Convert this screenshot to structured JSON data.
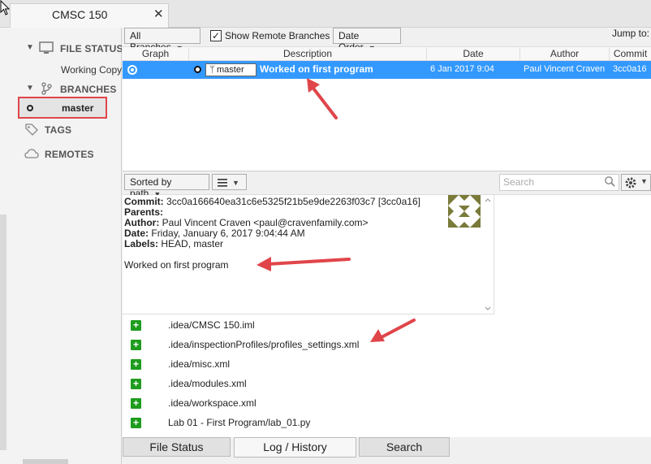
{
  "window": {
    "tab_title": "CMSC 150",
    "close_glyph": "✕"
  },
  "sidebar": {
    "file_status": {
      "label": "FILE STATUS",
      "sub": "Working Copy"
    },
    "branches": {
      "label": "BRANCHES",
      "current": "master"
    },
    "tags": {
      "label": "TAGS"
    },
    "remotes": {
      "label": "REMOTES"
    }
  },
  "toolbar": {
    "branches_filter": "All Branches",
    "show_remote": {
      "label": "Show Remote Branches",
      "checked": true
    },
    "order": "Date Order",
    "jump_to": "Jump to:"
  },
  "log": {
    "columns": [
      "Graph",
      "Description",
      "Date",
      "Author",
      "Commit"
    ],
    "rows": [
      {
        "branch_tag": "master",
        "description": "Worked on first program",
        "date": "6 Jan 2017 9:04",
        "author": "Paul Vincent Craven",
        "commit": "3cc0a16"
      }
    ]
  },
  "file_toolbar": {
    "sort": "Sorted by path",
    "search_placeholder": "Search"
  },
  "details": {
    "commit_label": "Commit:",
    "commit_value": "3cc0a166640ea31c6e5325f21b5e9de2263f03c7 [3cc0a16]",
    "parents_label": "Parents:",
    "author_label": "Author:",
    "author_value": "Paul Vincent Craven <paul@cravenfamily.com>",
    "date_label": "Date:",
    "date_value": "Friday, January 6, 2017 9:04:44 AM",
    "labels_label": "Labels:",
    "labels_value": "HEAD, master",
    "message": "Worked on first program"
  },
  "files": [
    ".idea/CMSC 150.iml",
    ".idea/inspectionProfiles/profiles_settings.xml",
    ".idea/misc.xml",
    ".idea/modules.xml",
    ".idea/workspace.xml",
    "Lab 01 - First Program/lab_01.py"
  ],
  "bottom_tabs": [
    "File Status",
    "Log / History",
    "Search"
  ],
  "colors": {
    "selection": "#3399ff",
    "annotation": "#e0454a",
    "added": "#1f9c1f"
  }
}
